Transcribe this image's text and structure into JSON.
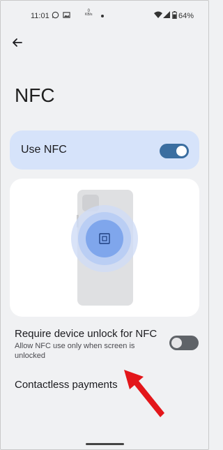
{
  "status_bar": {
    "time": "11:01",
    "net_speed_unit": "KB/s",
    "battery": "64%"
  },
  "page": {
    "title": "NFC"
  },
  "use_nfc": {
    "label": "Use NFC",
    "enabled": true
  },
  "unlock_setting": {
    "title": "Require device unlock for NFC",
    "subtitle": "Allow NFC use only when screen is unlocked",
    "enabled": false
  },
  "payments": {
    "label": "Contactless payments"
  },
  "colors": {
    "accent": "#3b6ea0",
    "use_card_bg": "#d6e3fa",
    "annotation_arrow": "#e3161a"
  }
}
